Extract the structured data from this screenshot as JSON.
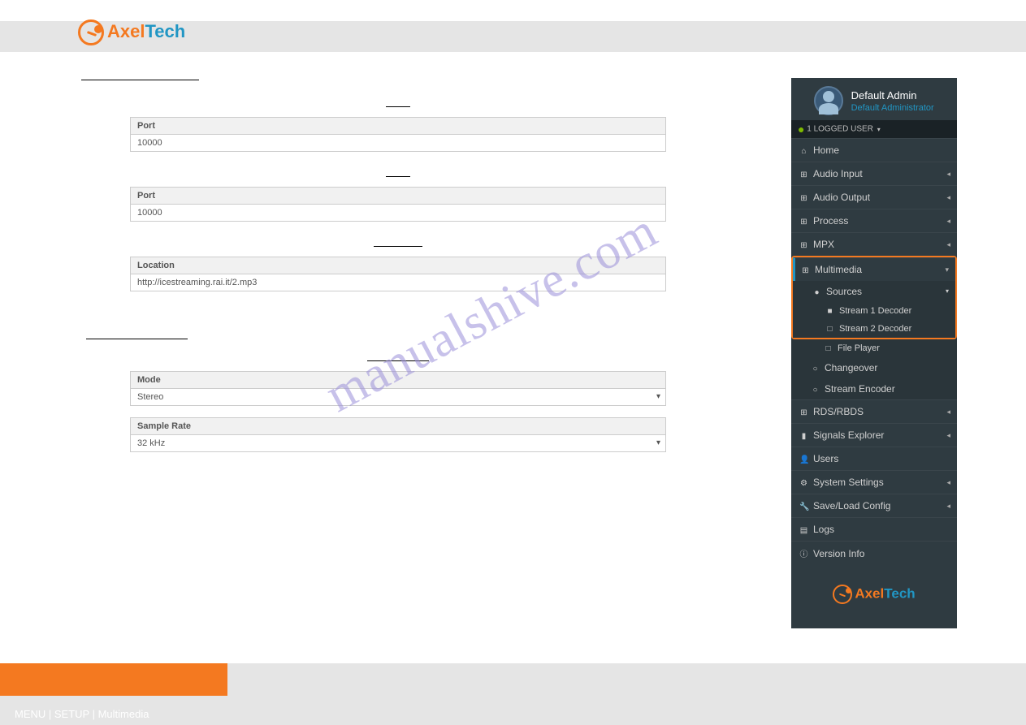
{
  "brand": {
    "part1": "Axel",
    "part2": "Tech"
  },
  "fields": {
    "port1": {
      "label": "Port",
      "value": "10000"
    },
    "port2": {
      "label": "Port",
      "value": "10000"
    },
    "location": {
      "label": "Location",
      "value": "http://icestreaming.rai.it/2.mp3"
    },
    "mode": {
      "label": "Mode",
      "value": "Stereo"
    },
    "sample_rate": {
      "label": "Sample Rate",
      "value": "32 kHz"
    }
  },
  "sidebar": {
    "user_name": "Default Admin",
    "user_role": "Default Administrator",
    "status": "1 LOGGED USER",
    "items": {
      "home": "Home",
      "audio_input": "Audio Input",
      "audio_output": "Audio Output",
      "process": "Process",
      "mpx": "MPX",
      "multimedia": "Multimedia",
      "sources": "Sources",
      "stream1": "Stream 1 Decoder",
      "stream2": "Stream 2 Decoder",
      "file_player": "File Player",
      "changeover": "Changeover",
      "stream_encoder": "Stream Encoder",
      "rds": "RDS/RBDS",
      "signals": "Signals Explorer",
      "users": "Users",
      "system": "System Settings",
      "saveload": "Save/Load Config",
      "logs": "Logs",
      "version": "Version Info"
    }
  },
  "watermark": "manualshive.com",
  "footer": "MENU | SETUP | Multimedia"
}
